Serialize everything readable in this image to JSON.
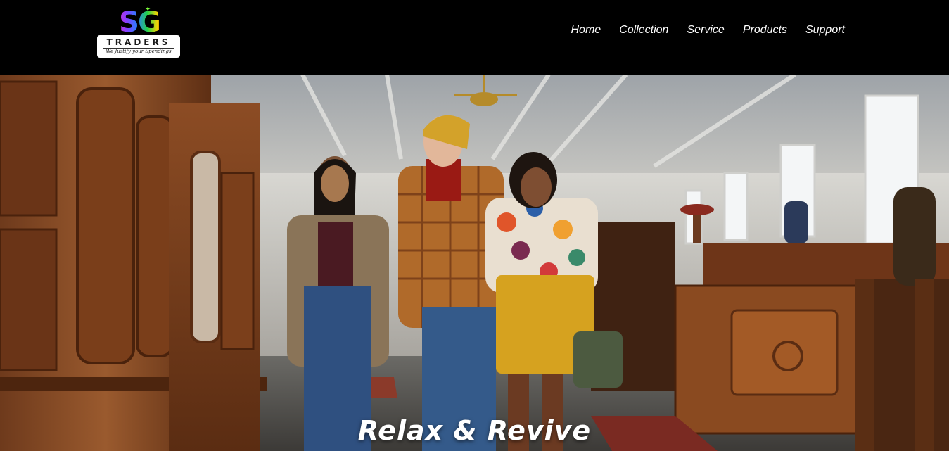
{
  "brand": {
    "logo_letters": "SG",
    "logo_name": "TRADERS",
    "logo_tagline": "We Justify your Spendings"
  },
  "nav": {
    "items": [
      {
        "label": "Home"
      },
      {
        "label": "Collection"
      },
      {
        "label": "Service"
      },
      {
        "label": "Products"
      },
      {
        "label": "Support"
      }
    ]
  },
  "hero": {
    "caption": "Relax & Revive"
  },
  "colors": {
    "header_bg": "#000000",
    "nav_text": "#ffffff",
    "caption_text": "#ffffff"
  }
}
